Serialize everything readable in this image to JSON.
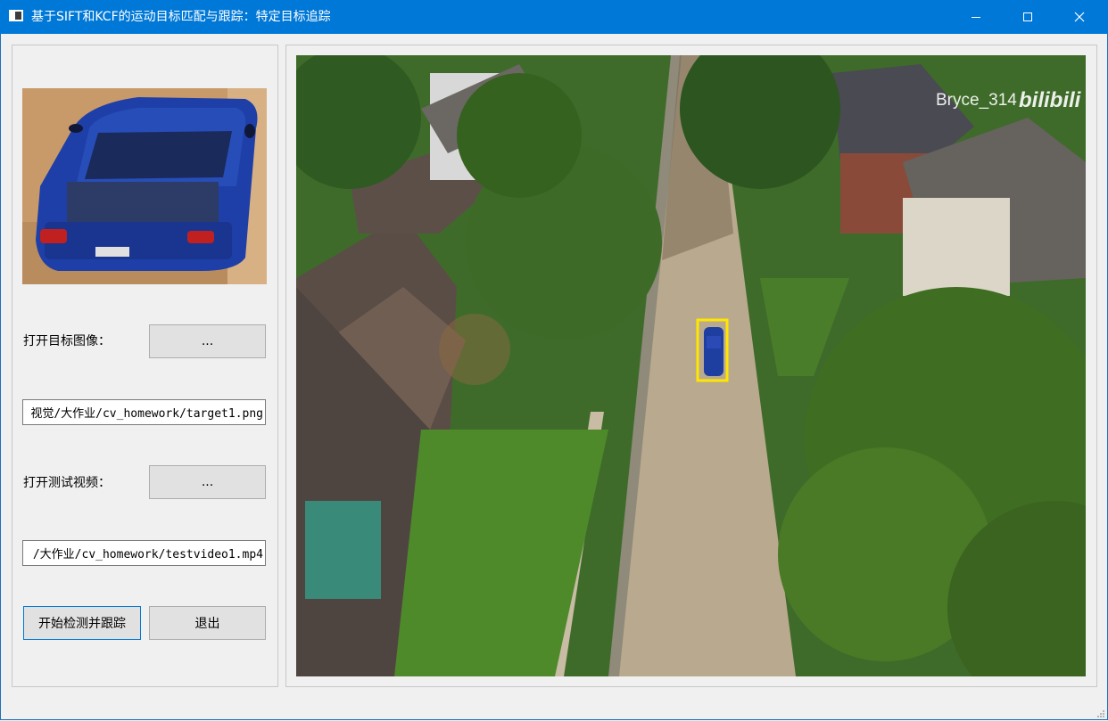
{
  "window": {
    "title": "基于SIFT和KCF的运动目标匹配与跟踪：特定目标追踪"
  },
  "controls": {
    "open_target_label": "打开目标图像：",
    "open_target_button": "...",
    "target_path": "视觉/大作业/cv_homework/target1.png",
    "open_video_label": "打开测试视频：",
    "open_video_button": "...",
    "video_path": "/大作业/cv_homework/testvideo1.mp4",
    "start_button": "开始检测并跟踪",
    "exit_button": "退出"
  },
  "video": {
    "watermark_user": "Bryce_314",
    "watermark_brand": "bilibili",
    "tracking_box_color": "#ffe600"
  },
  "colors": {
    "titlebar": "#0078d7",
    "window_bg": "#f0f0f0"
  }
}
